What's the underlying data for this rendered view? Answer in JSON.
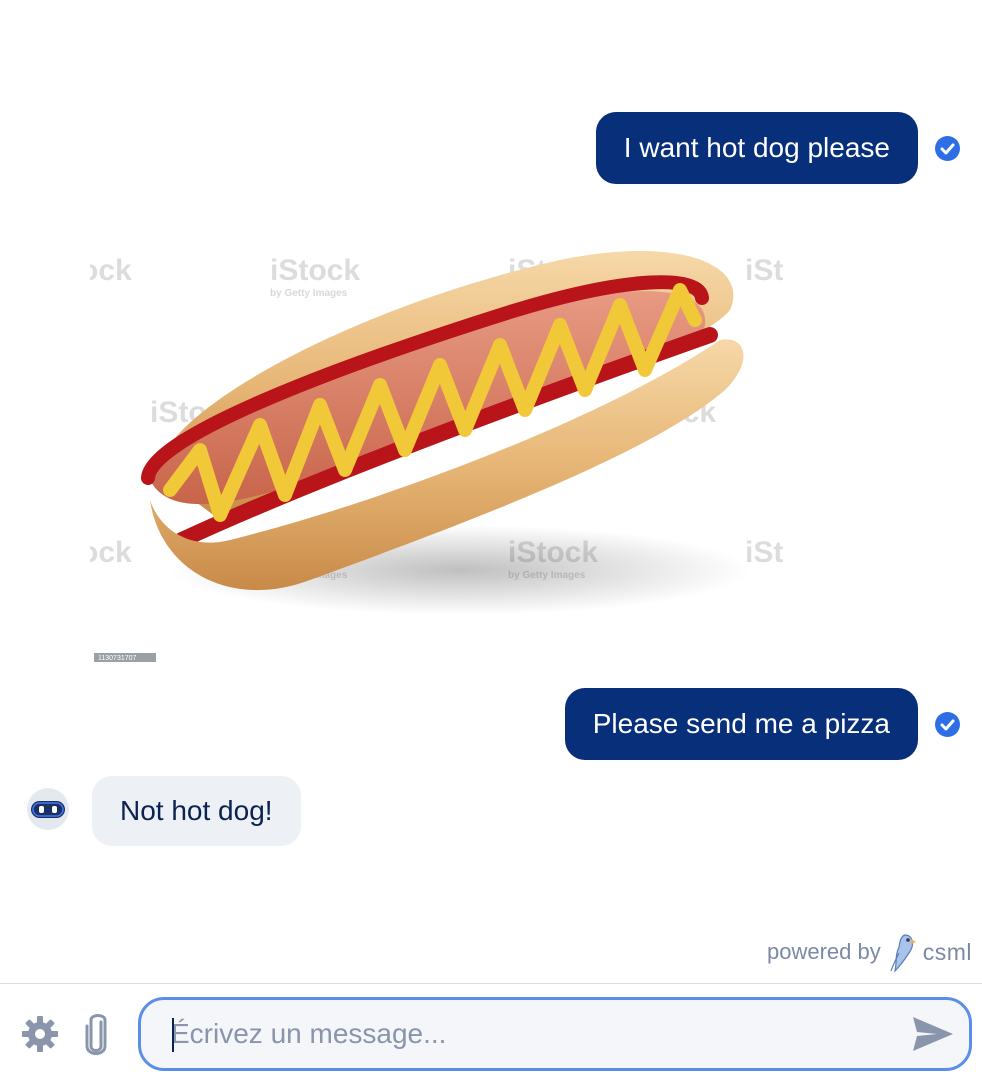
{
  "messages": [
    {
      "from": "user",
      "text": "I want hot dog please",
      "status": "sent"
    },
    {
      "from": "user",
      "type": "image",
      "image_subject": "hot dog with ketchup and mustard",
      "watermark_text": "iStock",
      "watermark_sub": "by Getty Images",
      "image_id_label": "1130731707"
    },
    {
      "from": "user",
      "text": "Please send me a pizza",
      "status": "sent"
    },
    {
      "from": "bot",
      "text": "Not hot dog!"
    }
  ],
  "footer": {
    "powered_by": "powered by",
    "brand": "csml"
  },
  "composer": {
    "placeholder": "Écrivez un message...",
    "icons": [
      "gear-icon",
      "paperclip-icon",
      "send-icon"
    ]
  },
  "colors": {
    "user_bubble": "#072f7a",
    "bot_bubble": "#edf0f5",
    "check": "#2f6fe4",
    "input_border": "#5b8ee6"
  }
}
